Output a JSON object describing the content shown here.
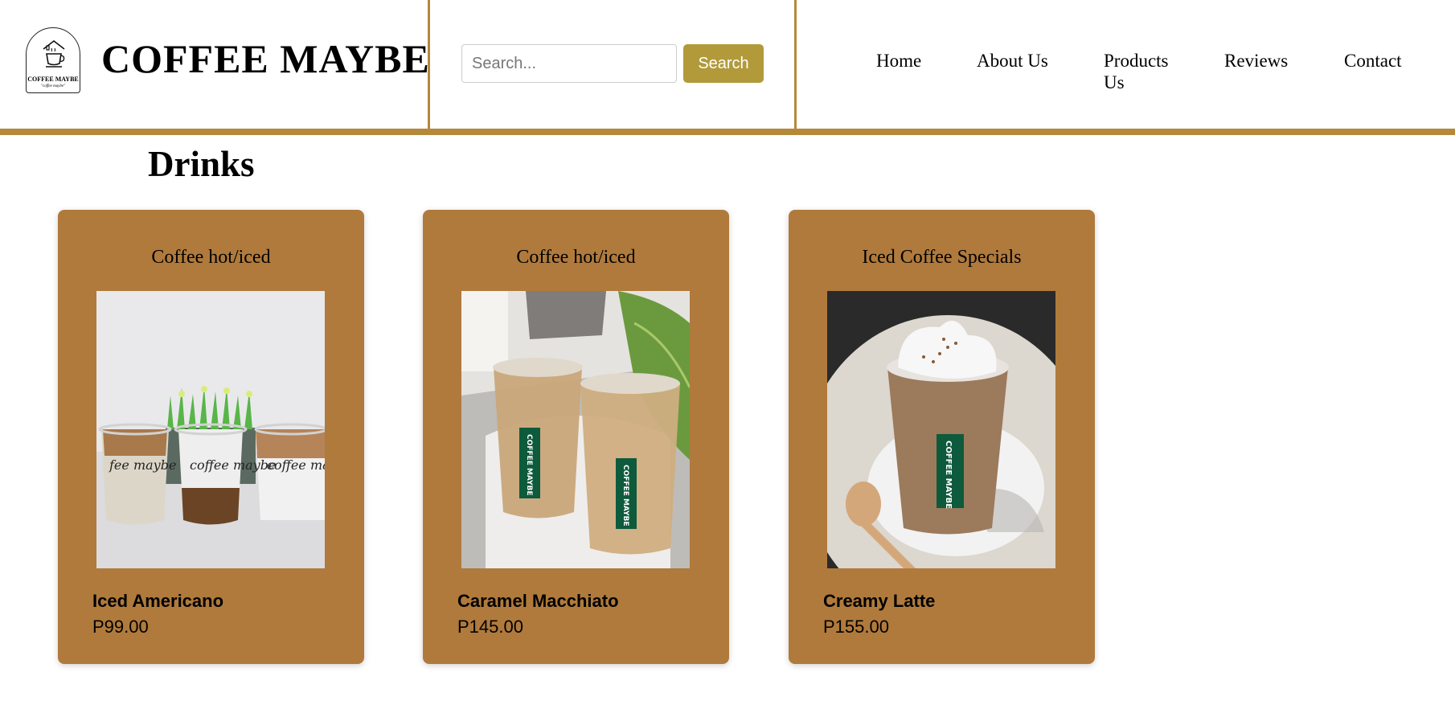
{
  "header": {
    "logo_text": "COFFEE MAYBE",
    "logo_subtext": "\"coffee maybe\"",
    "brand": "COFFEE MAYBE",
    "search": {
      "placeholder": "Search...",
      "button_label": "Search"
    },
    "nav": [
      "Home",
      "About Us",
      "Products Us",
      "Reviews",
      "Contact"
    ]
  },
  "main": {
    "section_title": "Drinks",
    "products": [
      {
        "category": "Coffee hot/iced",
        "name": "Iced Americano",
        "price": "P99.00",
        "image_icon": "iced-americano-photo"
      },
      {
        "category": "Coffee hot/iced",
        "name": "Caramel Macchiato",
        "price": "P145.00",
        "image_icon": "caramel-macchiato-photo"
      },
      {
        "category": "Iced Coffee Specials",
        "name": "Creamy Latte",
        "price": "P155.00",
        "image_icon": "creamy-latte-photo"
      }
    ]
  },
  "colors": {
    "accent": "#b5883a",
    "card": "#b07a3c",
    "button": "#b29a3a"
  }
}
